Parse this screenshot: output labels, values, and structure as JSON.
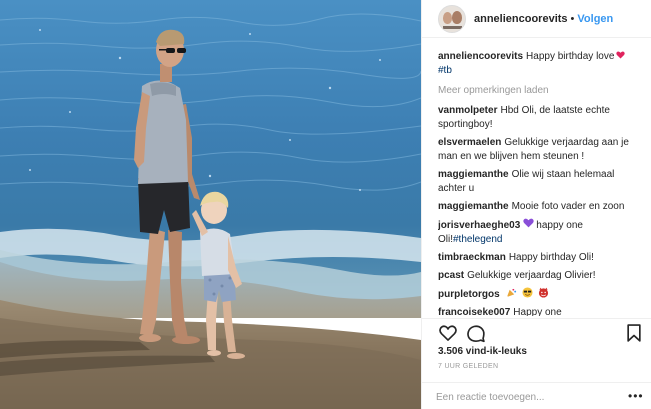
{
  "header": {
    "username": "anneliencoorevits",
    "separator": "•",
    "follow_label": "Volgen",
    "avatar_icon": "profile-photo-avatar"
  },
  "caption": {
    "username": "anneliencoorevits",
    "text": "Happy birthday love",
    "hashtag": "#tb",
    "emoji": "red-heart"
  },
  "load_more_label": "Meer opmerkingen laden",
  "comments": [
    {
      "user": "vanmolpeter",
      "text": "Hbd Oli, de laatste echte sportingboy!"
    },
    {
      "user": "elsvermaelen",
      "text": "Gelukkige verjaardag aan je man en we blijven hem steunen !"
    },
    {
      "user": "maggiemanthe",
      "text": "Olie wij staan helemaal achter u"
    },
    {
      "user": "maggiemanthe",
      "text": "Mooie foto vader en zoon"
    },
    {
      "user": "jorisverhaeghe03",
      "text": "happy one Oli!",
      "hashtag": "#thelegend",
      "emoji": "purple-heart"
    },
    {
      "user": "timbraeckman",
      "text": "Happy birthday Oli!"
    },
    {
      "user": "pcast",
      "text": "Gelukkige verjaardag Olivier!"
    },
    {
      "user": "purpletorgos",
      "text": "",
      "emoji": "party-popper, smiling-face-with-sunglasses, smiling-devil"
    },
    {
      "user": "francoiseke007",
      "text": "Happy one"
    }
  ],
  "actions": {
    "like_icon": "heart-outline-icon",
    "comment_icon": "speech-bubble-icon",
    "save_icon": "bookmark-icon"
  },
  "likes_text": "3.506 vind-ik-leuks",
  "time_text": "7 UUR GELEDEN",
  "add_comment": {
    "placeholder": "Een reactie toevoegen...",
    "more_label": "•••"
  },
  "colors": {
    "link_blue": "#3897f0",
    "hashtag_blue": "#003569",
    "muted": "#999999",
    "sea": "#3f83b4",
    "sand": "#8c7a62"
  }
}
